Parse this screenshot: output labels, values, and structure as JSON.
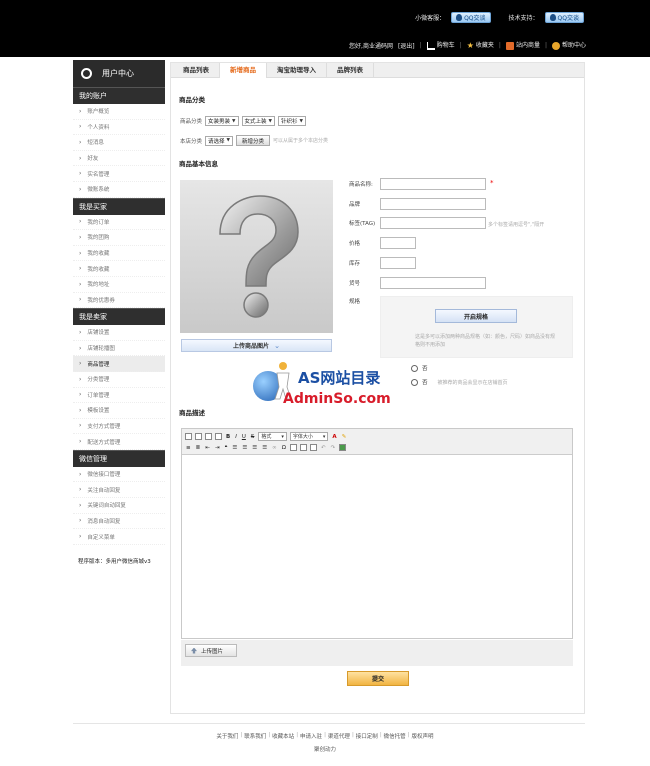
{
  "topbar": {
    "service_label": "小微客服：",
    "service_btn": "QQ交谈",
    "tech_label": "技术支持：",
    "tech_btn": "QQ交谈",
    "welcome": "您好,商业通码网",
    "logout": "[退出]",
    "cart": "购物车",
    "favorites": "收藏夹",
    "site_nav": "站内商量",
    "help": "帮助中心"
  },
  "sidebar": {
    "header": "用户中心",
    "sections": [
      {
        "title": "我的账户",
        "items": [
          "账户概览",
          "个人资料",
          "短消息",
          "好友",
          "实名管理",
          "微账系统"
        ]
      },
      {
        "title": "我是买家",
        "items": [
          "我的订单",
          "我的团购",
          "我的收藏",
          "我的收藏",
          "我的地址",
          "我的优惠券"
        ]
      },
      {
        "title": "我是卖家",
        "items": [
          "店铺设置",
          "店铺轮播图",
          "商品管理",
          "分类管理",
          "订单管理",
          "模板设置",
          "支付方式管理",
          "配送方式管理"
        ]
      },
      {
        "title": "微信管理",
        "items": [
          "微信接口管理",
          "关注自动回复",
          "关键词自动回复",
          "消息自动回复",
          "自定义菜单"
        ]
      }
    ],
    "active_item": "商品管理",
    "version": "程序版本：多用户微信商城v3"
  },
  "tabs": [
    "商品列表",
    "新增商品",
    "淘宝助理导入",
    "品牌列表"
  ],
  "active_tab": "新增商品",
  "category": {
    "title": "商品分类",
    "label": "商品分类",
    "sel1": "女装男装",
    "sel2": "女式上装",
    "sel3": "针织衫",
    "store_label": "本店分类",
    "store_sel": "请选择",
    "add_btn": "新增分类",
    "hint": "可以从属于多个本店分类"
  },
  "basic": {
    "title": "商品基本信息",
    "upload_btn": "上传商品图片",
    "name_label": "商品名称:",
    "brand_label": "品牌",
    "tag_label": "标签(TAG)",
    "tag_hint": "多个标签请用逗号\",\"隔开",
    "price_label": "价格",
    "stock_label": "库存",
    "sn_label": "货号",
    "spec_label": "规格",
    "spec_btn": "开启规格",
    "spec_hint": "这是多可以添加两种商品规格（如：颜色，尺码）如商品没有规格则不用添加",
    "radio1": "否",
    "radio2": "否",
    "radio_hint": "被推荐的商品会显示在店铺首页",
    "watermark_title": "AS网站目录",
    "watermark_url": "AdminSo.com"
  },
  "desc": {
    "title": "商品描述",
    "format_label": "格式",
    "fontsize_label": "字体大小",
    "upload_img_btn": "上传图片"
  },
  "submit_btn": "提交",
  "footer": {
    "links": [
      "关于我们",
      "联系我们",
      "收藏本站",
      "申请入驻",
      "渠道代理",
      "接口定制",
      "微信托管",
      "版权声明"
    ],
    "powered": "聚创动力"
  }
}
